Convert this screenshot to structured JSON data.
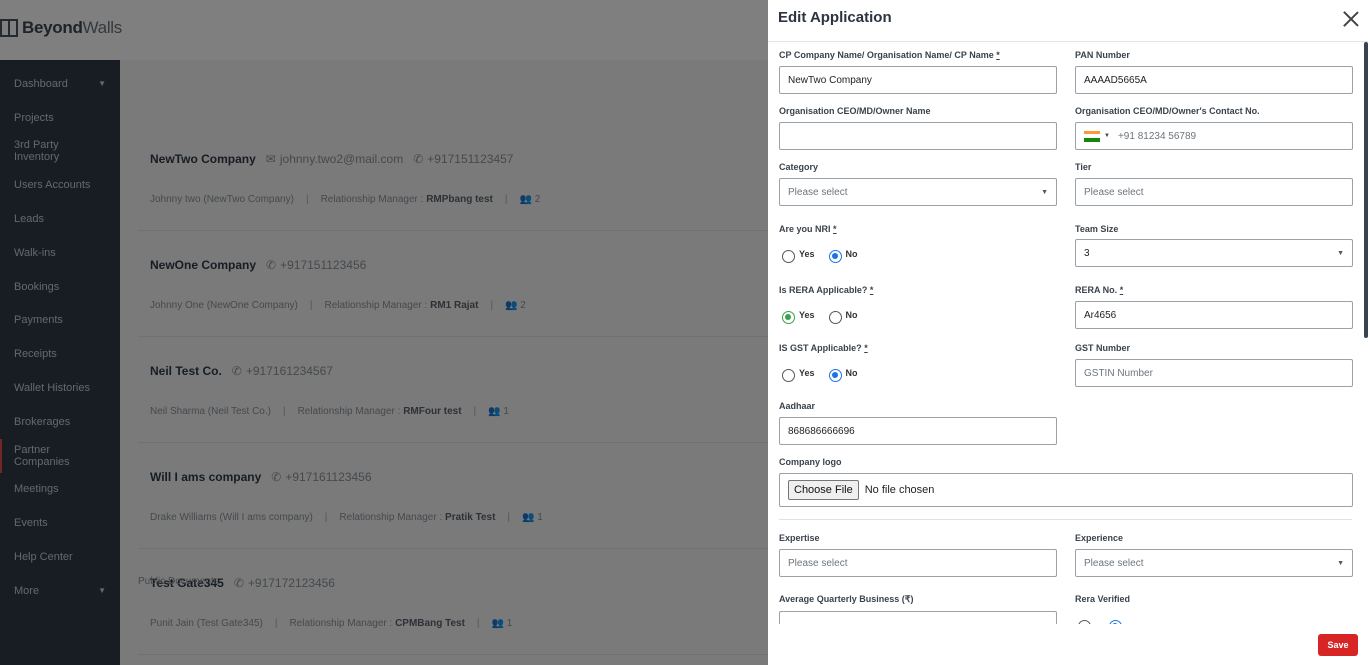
{
  "app": {
    "brand_bold": "Beyond",
    "brand_light": "Walls"
  },
  "sidebar": {
    "items": [
      {
        "label": "Dashboard",
        "caret": true
      },
      {
        "label": "Projects"
      },
      {
        "label": "3rd Party Inventory"
      },
      {
        "label": "Users Accounts"
      },
      {
        "label": "Leads"
      },
      {
        "label": "Walk-ins"
      },
      {
        "label": "Bookings"
      },
      {
        "label": "Payments"
      },
      {
        "label": "Receipts"
      },
      {
        "label": "Wallet Histories"
      },
      {
        "label": "Brokerages"
      },
      {
        "label": "Partner Companies",
        "active": true
      },
      {
        "label": "Meetings"
      },
      {
        "label": "Events"
      },
      {
        "label": "Help Center"
      },
      {
        "label": "More",
        "caret": true
      }
    ]
  },
  "companies": [
    {
      "name": "NewTwo Company",
      "email": "johnny.two2@mail.com",
      "phone": "+917151123457",
      "contact": "Johnny two (NewTwo Company)",
      "rm_label": "Relationship Manager :",
      "rm": "RMPbang test",
      "count": "2"
    },
    {
      "name": "NewOne Company",
      "email": "",
      "phone": "+917151123456",
      "contact": "Johnny One (NewOne Company)",
      "rm_label": "Relationship Manager :",
      "rm": "RM1 Rajat",
      "count": "2"
    },
    {
      "name": "Neil Test Co.",
      "email": "",
      "phone": "+917161234567",
      "contact": "Neil Sharma (Neil Test Co.)",
      "rm_label": "Relationship Manager :",
      "rm": "RMFour test",
      "count": "1"
    },
    {
      "name": "Will I ams company",
      "email": "",
      "phone": "+917161123456",
      "contact": "Drake Williams (Will I ams company)",
      "rm_label": "Relationship Manager :",
      "rm": "Pratik Test",
      "count": "1"
    },
    {
      "name": "Test Gate345",
      "email": "",
      "phone": "+917172123456",
      "contact": "Punit Jain (Test Gate345)",
      "rm_label": "Relationship Manager :",
      "rm": "CPMBang Test",
      "count": "1"
    }
  ],
  "footer_note": "Public Documents",
  "modal": {
    "title": "Edit Application",
    "cp_name": {
      "label": "CP Company Name/ Organisation Name/ CP Name",
      "value": "NewTwo Company"
    },
    "pan": {
      "label": "PAN Number",
      "value": "AAAAD5665A"
    },
    "ceo_name": {
      "label": "Organisation CEO/MD/Owner Name",
      "value": ""
    },
    "ceo_contact": {
      "label": "Organisation CEO/MD/Owner's Contact No.",
      "placeholder": "+91 81234 56789"
    },
    "category": {
      "label": "Category",
      "placeholder": "Please select"
    },
    "tier": {
      "label": "Tier",
      "placeholder": "Please select"
    },
    "nri": {
      "label": "Are you NRI",
      "yes": "Yes",
      "no": "No",
      "selected": "No"
    },
    "team_size": {
      "label": "Team Size",
      "value": "3"
    },
    "rera": {
      "label": "Is RERA Applicable?",
      "yes": "Yes",
      "no": "No",
      "selected": "Yes"
    },
    "rera_no": {
      "label": "RERA No.",
      "value": "Ar4656"
    },
    "gst": {
      "label": "IS GST Applicable?",
      "yes": "Yes",
      "no": "No",
      "selected": "No"
    },
    "gst_number": {
      "label": "GST Number",
      "placeholder": "GSTIN Number"
    },
    "aadhaar": {
      "label": "Aadhaar",
      "value": "868686666696"
    },
    "logo": {
      "label": "Company logo",
      "button": "Choose File",
      "status": "No file chosen"
    },
    "expertise": {
      "label": "Expertise",
      "placeholder": "Please select"
    },
    "experience": {
      "label": "Experience",
      "placeholder": "Please select"
    },
    "avg_business": {
      "label": "Average Quarterly Business (₹)"
    },
    "rera_verified": {
      "label": "Rera Verified"
    },
    "required_mark": "*",
    "save_label": "Save"
  },
  "colors": {
    "sidebar_bg": "#2f3a45",
    "accent_blue": "#1a73e8",
    "accent_green": "#3aa24a",
    "save_red": "#d72525"
  }
}
